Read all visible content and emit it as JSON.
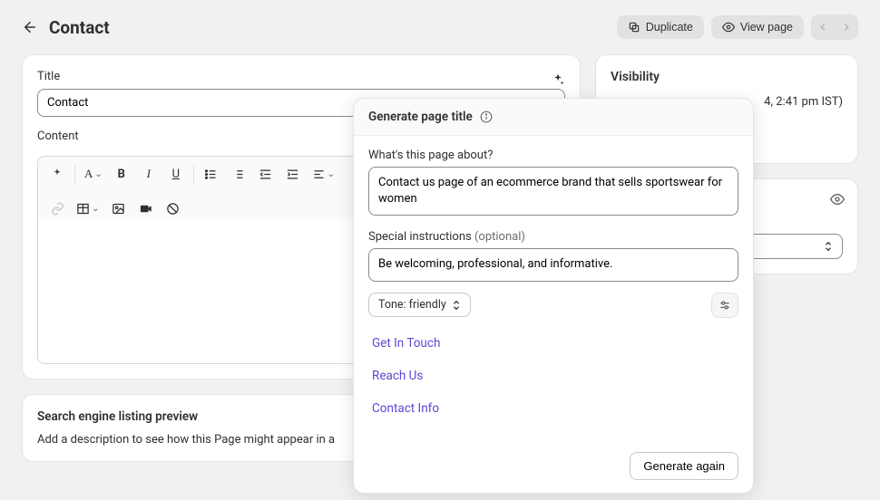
{
  "header": {
    "title": "Contact",
    "duplicate_label": "Duplicate",
    "view_page_label": "View page"
  },
  "editor": {
    "title_label": "Title",
    "title_value": "Contact",
    "content_label": "Content"
  },
  "popover": {
    "heading": "Generate page title",
    "about_label": "What's this page about?",
    "about_value": "Contact us page of an ecommerce brand that sells sportswear for women",
    "special_label": "Special instructions",
    "special_optional": "(optional)",
    "special_value": "Be welcoming, professional, and informative.",
    "tone_label": "Tone: friendly",
    "suggestions": [
      "Get In Touch",
      "Reach Us",
      "Contact Info"
    ],
    "generate_label": "Generate again"
  },
  "seo": {
    "heading": "Search engine listing preview",
    "description": "Add a description to see how this Page might appear in a"
  },
  "visibility": {
    "heading": "Visibility",
    "line": "4, 2:41 pm IST)"
  }
}
